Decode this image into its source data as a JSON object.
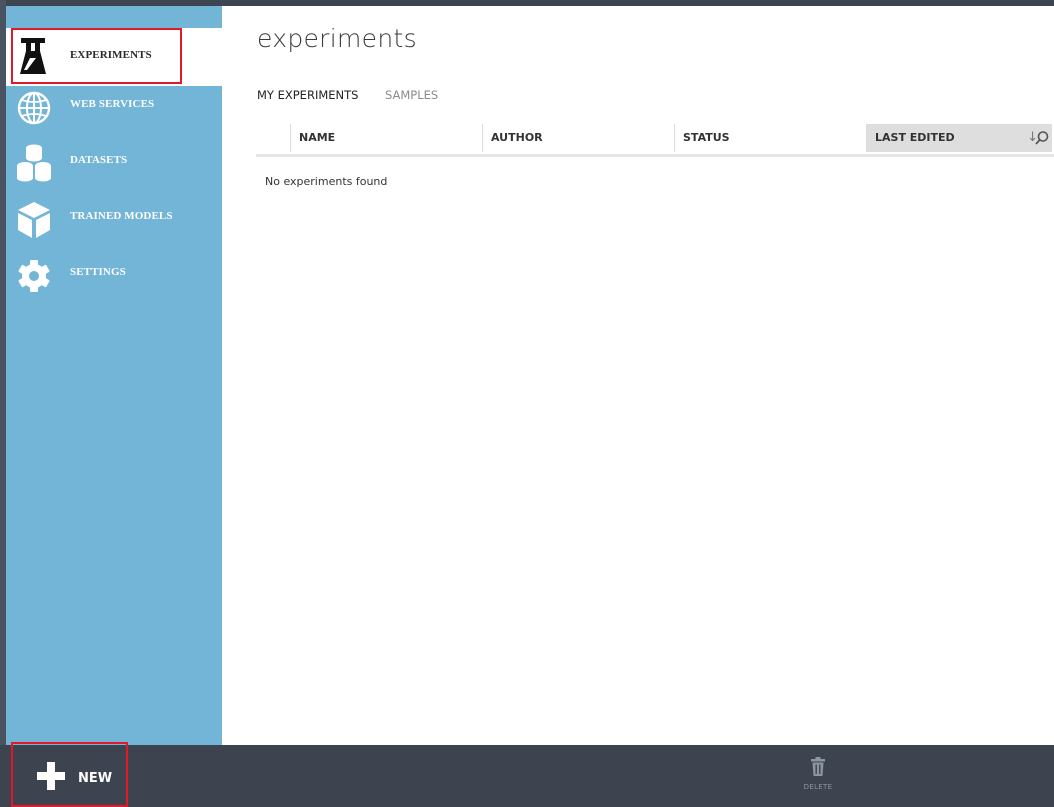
{
  "sidebar": {
    "items": [
      {
        "label": "EXPERIMENTS",
        "icon": "flask-icon",
        "active": true
      },
      {
        "label": "WEB SERVICES",
        "icon": "globe-icon",
        "active": false
      },
      {
        "label": "DATASETS",
        "icon": "database-icon",
        "active": false
      },
      {
        "label": "TRAINED MODELS",
        "icon": "cube-icon",
        "active": false
      },
      {
        "label": "SETTINGS",
        "icon": "gear-icon",
        "active": false
      }
    ]
  },
  "main": {
    "title": "experiments",
    "tabs": [
      {
        "label": "MY EXPERIMENTS",
        "active": true
      },
      {
        "label": "SAMPLES",
        "active": false
      }
    ],
    "table": {
      "columns": [
        "NAME",
        "AUTHOR",
        "STATUS",
        "LAST EDITED"
      ],
      "sort_column": "LAST EDITED",
      "sort_direction": "descending",
      "empty_message": "No experiments found"
    }
  },
  "bottom_bar": {
    "new_label": "NEW",
    "delete_label": "DELETE"
  },
  "colors": {
    "sidebar_bg": "#73b5d7",
    "bottom_bar_bg": "#3d4450",
    "highlight": "#e0192b",
    "active_item_bg": "#ffffff"
  }
}
